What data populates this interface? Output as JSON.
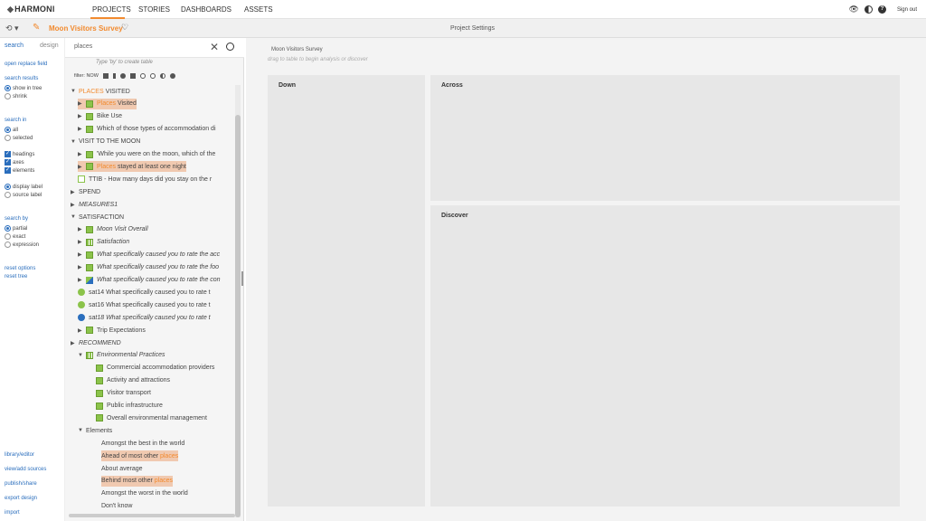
{
  "app": {
    "logo": "HARMONI"
  },
  "nav": {
    "items": [
      "PROJECTS",
      "STORIES",
      "DASHBOARDS",
      "ASSETS"
    ],
    "signout": "Sign out"
  },
  "subbar": {
    "project_name": "Moon Visitors Survey",
    "title": "Project Settings"
  },
  "side": {
    "tab_search": "search",
    "tab_design": "design",
    "open_replace": "open replace field",
    "search_results": "search results",
    "show_in_tree": "show in tree",
    "shrink": "shrink",
    "search_in": "search in",
    "all": "all",
    "selected": "selected",
    "headings": "headings",
    "axes": "axes",
    "elements": "elements",
    "display_label": "display label",
    "source_label": "source label",
    "search_by": "search by",
    "partial": "partial",
    "exact": "exact",
    "expression": "expression",
    "reset_options": "reset options",
    "reset_tree": "reset tree",
    "library": "library/editor",
    "view_sources": "view/add sources",
    "publish": "publish/share",
    "export": "export design",
    "import": "import"
  },
  "tree_panel": {
    "search_value": "places",
    "hint": "Type 'by' to create table",
    "filter_label": "filter: NOW"
  },
  "tree": [
    {
      "pre": "",
      "match": "PLACES",
      "post": " VISITED",
      "indent": 0,
      "arrow": "▼",
      "icon": "",
      "hl": false,
      "italic": false
    },
    {
      "pre": "",
      "match": "Places",
      "post": " Visited",
      "indent": 1,
      "arrow": "▶",
      "icon": "green",
      "hl": true,
      "italic": false
    },
    {
      "pre": "Bike Use",
      "match": "",
      "post": "",
      "indent": 1,
      "arrow": "▶",
      "icon": "green",
      "hl": false,
      "italic": false
    },
    {
      "pre": "Which of those types of accommodation di",
      "match": "",
      "post": "",
      "indent": 1,
      "arrow": "▶",
      "icon": "green",
      "hl": false,
      "italic": false
    },
    {
      "pre": "VISIT TO THE MOON",
      "match": "",
      "post": "",
      "indent": 0,
      "arrow": "▼",
      "icon": "",
      "hl": false,
      "italic": false
    },
    {
      "pre": "'While you were on the moon, which of the",
      "match": "",
      "post": "",
      "indent": 1,
      "arrow": "▶",
      "icon": "green",
      "hl": false,
      "italic": false
    },
    {
      "pre": "",
      "match": "Places",
      "post": " stayed at least one night",
      "indent": 1,
      "arrow": "▶",
      "icon": "green",
      "hl": true,
      "italic": false
    },
    {
      "pre": "TTIB - How many days did you stay on the r",
      "match": "",
      "post": "",
      "indent": 1,
      "arrow": "",
      "icon": "num",
      "hl": false,
      "italic": false
    },
    {
      "pre": "SPEND",
      "match": "",
      "post": "",
      "indent": 0,
      "arrow": "▶",
      "icon": "",
      "hl": false,
      "italic": false,
      "pad": 1
    },
    {
      "pre": "MEASURES1",
      "match": "",
      "post": "",
      "indent": 0,
      "arrow": "▶",
      "icon": "",
      "hl": false,
      "italic": true,
      "pad": 1
    },
    {
      "pre": "SATISFACTION",
      "match": "",
      "post": "",
      "indent": 0,
      "arrow": "▼",
      "icon": "",
      "hl": false,
      "italic": false
    },
    {
      "pre": "Moon Visit Overall",
      "match": "",
      "post": "",
      "indent": 1,
      "arrow": "▶",
      "icon": "green",
      "hl": false,
      "italic": true
    },
    {
      "pre": "Satisfaction",
      "match": "",
      "post": "",
      "indent": 1,
      "arrow": "▶",
      "icon": "grid",
      "hl": false,
      "italic": true
    },
    {
      "pre": "What specifically caused you to rate the acc",
      "match": "",
      "post": "",
      "indent": 1,
      "arrow": "▶",
      "icon": "green",
      "hl": false,
      "italic": true
    },
    {
      "pre": "What specifically caused you to rate the foo",
      "match": "",
      "post": "",
      "indent": 1,
      "arrow": "▶",
      "icon": "green",
      "hl": false,
      "italic": true
    },
    {
      "pre": "What specifically caused you to rate the con",
      "match": "",
      "post": "",
      "indent": 1,
      "arrow": "▶",
      "icon": "blue",
      "hl": false,
      "italic": true
    },
    {
      "pre": "sat14 What specifically caused you to rate t",
      "match": "",
      "post": "",
      "indent": 1,
      "arrow": "",
      "icon": "bubble",
      "hl": false,
      "italic": false
    },
    {
      "pre": "sat16 What specifically caused you to rate t",
      "match": "",
      "post": "",
      "indent": 1,
      "arrow": "",
      "icon": "bubble",
      "hl": false,
      "italic": false
    },
    {
      "pre": "sat18 What specifically caused you to rate t",
      "match": "",
      "post": "",
      "indent": 1,
      "arrow": "",
      "icon": "bubble-blue",
      "hl": false,
      "italic": true
    },
    {
      "pre": "Trip Expectations",
      "match": "",
      "post": "",
      "indent": 1,
      "arrow": "▶",
      "icon": "green",
      "hl": false,
      "italic": false
    },
    {
      "pre": "RECOMMEND",
      "match": "",
      "post": "",
      "indent": 0,
      "arrow": "▶",
      "icon": "",
      "hl": false,
      "italic": true,
      "pad": 1
    },
    {
      "pre": "Environmental Practices",
      "match": "",
      "post": "",
      "indent": 1,
      "arrow": "▼",
      "icon": "grid",
      "hl": false,
      "italic": true
    },
    {
      "pre": "Commercial accommodation providers",
      "match": "",
      "post": "",
      "indent": 2,
      "arrow": "",
      "icon": "green",
      "hl": false,
      "italic": false
    },
    {
      "pre": "Activity and attractions",
      "match": "",
      "post": "",
      "indent": 2,
      "arrow": "",
      "icon": "green",
      "hl": false,
      "italic": false
    },
    {
      "pre": "Visitor transport",
      "match": "",
      "post": "",
      "indent": 2,
      "arrow": "",
      "icon": "green",
      "hl": false,
      "italic": false
    },
    {
      "pre": "Public infrastructure",
      "match": "",
      "post": "",
      "indent": 2,
      "arrow": "",
      "icon": "green",
      "hl": false,
      "italic": false
    },
    {
      "pre": "Overall environmental management",
      "match": "",
      "post": "",
      "indent": 2,
      "arrow": "",
      "icon": "green",
      "hl": false,
      "italic": false
    },
    {
      "pre": "Elements",
      "match": "",
      "post": "",
      "indent": 1,
      "arrow": "▼",
      "icon": "",
      "hl": false,
      "italic": false,
      "pad": 1
    },
    {
      "pre": "Amongst the best in the world",
      "match": "",
      "post": "",
      "indent": 3,
      "arrow": "",
      "icon": "",
      "hl": false,
      "italic": false
    },
    {
      "pre": "Ahead of most other ",
      "match": "places",
      "post": "",
      "indent": 3,
      "arrow": "",
      "icon": "",
      "hl": true,
      "italic": false
    },
    {
      "pre": "About average",
      "match": "",
      "post": "",
      "indent": 3,
      "arrow": "",
      "icon": "",
      "hl": false,
      "italic": false
    },
    {
      "pre": "Behind most other ",
      "match": "places",
      "post": "",
      "indent": 3,
      "arrow": "",
      "icon": "",
      "hl": true,
      "italic": false
    },
    {
      "pre": "Amongst the worst in the world",
      "match": "",
      "post": "",
      "indent": 3,
      "arrow": "",
      "icon": "",
      "hl": false,
      "italic": false
    },
    {
      "pre": "Don't know",
      "match": "",
      "post": "",
      "indent": 3,
      "arrow": "",
      "icon": "",
      "hl": false,
      "italic": false
    }
  ],
  "main": {
    "survey_title": "Moon Visitors Survey",
    "hint": "drag to table to begin analysis or discover",
    "down": "Down",
    "across": "Across",
    "discover": "Discover"
  },
  "colors": {
    "accent": "#f28a2e",
    "link": "#2a6ebd",
    "highlight": "#f0c9b0",
    "question": "#8bc34a"
  }
}
